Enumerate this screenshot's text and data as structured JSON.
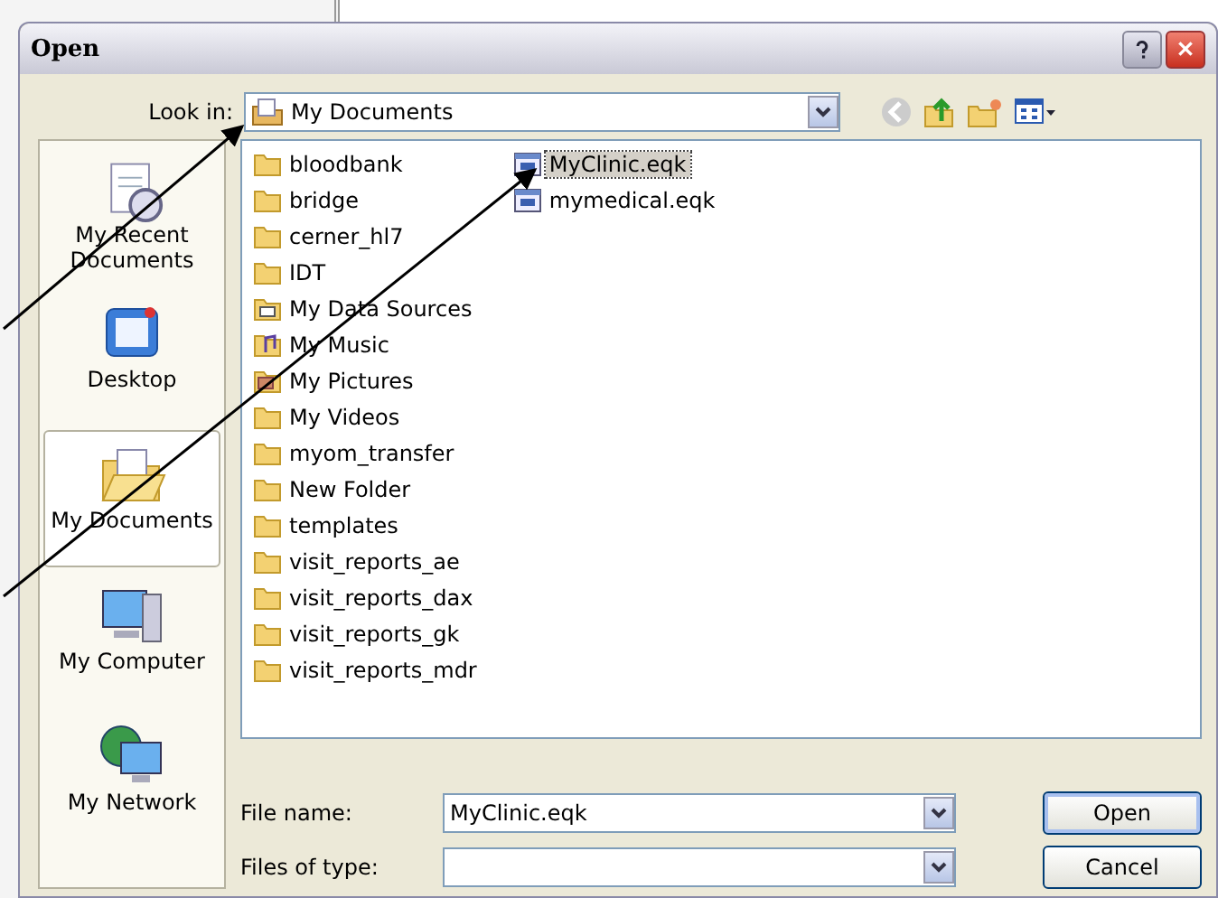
{
  "window": {
    "title": "Open"
  },
  "look_in": {
    "label": "Look in:",
    "value": "My Documents"
  },
  "places": [
    {
      "label": "My Recent Documents",
      "kind": "recent",
      "selected": false
    },
    {
      "label": "Desktop",
      "kind": "desktop",
      "selected": false
    },
    {
      "label": "My Documents",
      "kind": "documents",
      "selected": true
    },
    {
      "label": "My Computer",
      "kind": "computer",
      "selected": false
    },
    {
      "label": "My Network",
      "kind": "network",
      "selected": false
    }
  ],
  "files": [
    {
      "name": "bloodbank",
      "kind": "folder",
      "selected": false
    },
    {
      "name": "bridge",
      "kind": "folder",
      "selected": false
    },
    {
      "name": "cerner_hl7",
      "kind": "folder",
      "selected": false
    },
    {
      "name": "IDT",
      "kind": "folder",
      "selected": false
    },
    {
      "name": "My Data Sources",
      "kind": "datasource",
      "selected": false
    },
    {
      "name": "My Music",
      "kind": "music",
      "selected": false
    },
    {
      "name": "My Pictures",
      "kind": "pictures",
      "selected": false
    },
    {
      "name": "My Videos",
      "kind": "folder",
      "selected": false
    },
    {
      "name": "myom_transfer",
      "kind": "folder",
      "selected": false
    },
    {
      "name": "New Folder",
      "kind": "folder",
      "selected": false
    },
    {
      "name": "templates",
      "kind": "folder",
      "selected": false
    },
    {
      "name": "visit_reports_ae",
      "kind": "folder",
      "selected": false
    },
    {
      "name": "visit_reports_dax",
      "kind": "folder",
      "selected": false
    },
    {
      "name": "visit_reports_gk",
      "kind": "folder",
      "selected": false
    },
    {
      "name": "visit_reports_mdr",
      "kind": "folder",
      "selected": false
    },
    {
      "name": "MyClinic.eqk",
      "kind": "file",
      "selected": true
    },
    {
      "name": "mymedical.eqk",
      "kind": "file",
      "selected": false
    }
  ],
  "file_name": {
    "label": "File name:",
    "value": "MyClinic.eqk"
  },
  "file_type": {
    "label": "Files of type:"
  },
  "buttons": [
    "Open",
    "Cancel"
  ]
}
